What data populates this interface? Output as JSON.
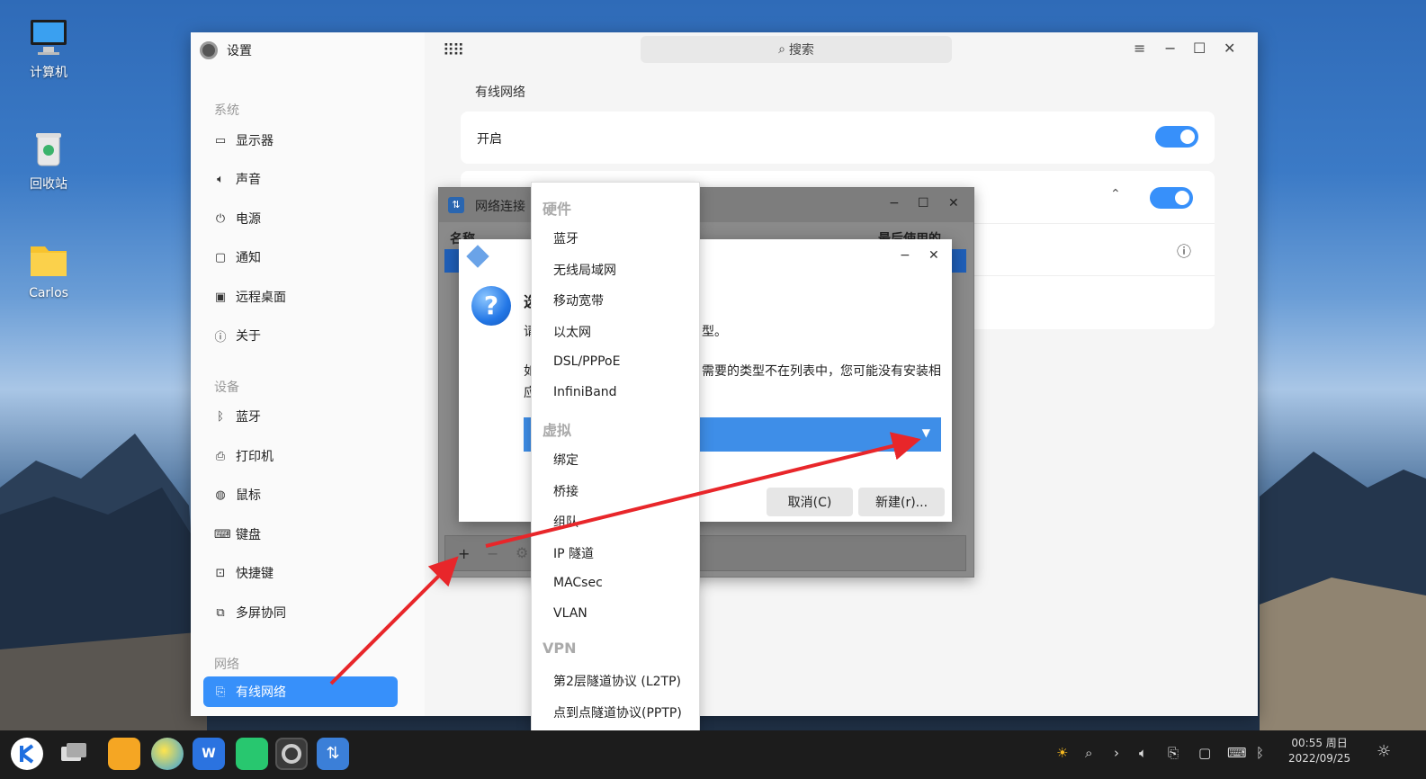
{
  "desktop": {
    "icons": [
      {
        "label": "计算机",
        "icon": "computer-icon"
      },
      {
        "label": "回收站",
        "icon": "trash-icon"
      },
      {
        "label": "Carlos",
        "icon": "folder-icon"
      }
    ]
  },
  "settings": {
    "title": "设置",
    "search_placeholder": "搜索",
    "sidebar": {
      "groups": {
        "system": "系统",
        "devices": "设备",
        "network": "网络"
      },
      "items": {
        "display": "显示器",
        "sound": "声音",
        "power": "电源",
        "notify": "通知",
        "remote": "远程桌面",
        "about": "关于",
        "bluetooth": "蓝牙",
        "printer": "打印机",
        "mouse": "鼠标",
        "keyboard": "键盘",
        "shortcuts": "快捷键",
        "multiscreen": "多屏协同",
        "wired": "有线网络"
      },
      "active": "有线网络"
    },
    "main": {
      "section_title": "有线网络",
      "enable_label": "开启",
      "enable_on": true,
      "connection_toggle_on": true
    }
  },
  "network_connections": {
    "title": "网络连接",
    "columns": [
      "名称",
      "最后使用的"
    ],
    "add_button": "+",
    "remove_button": "−",
    "settings_button": "⚙"
  },
  "choose_dialog": {
    "heading_visible": "选",
    "line1_start": "请",
    "line1_end": "型。",
    "line2_start": "如",
    "line2_end": "需要的类型不在列表中，您可能没有安装相",
    "line3_start": "应",
    "cancel_button": "取消(C)",
    "create_button": "新建(r)..."
  },
  "type_menu": {
    "groups": {
      "hardware": "硬件",
      "virtual": "虚拟",
      "vpn": "VPN"
    },
    "hardware": [
      "蓝牙",
      "无线局域网",
      "移动宽带",
      "以太网",
      "DSL/PPPoE",
      "InfiniBand"
    ],
    "virtual": [
      "绑定",
      "桥接",
      "组队",
      "IP 隧道",
      "MACsec",
      "VLAN"
    ],
    "vpn": [
      "第2层隧道协议 (L2TP)",
      "点到点隧道协议(PPTP)"
    ]
  },
  "taskbar": {
    "clock_time": "00:55 周日",
    "clock_date": "2022/09/25"
  },
  "colors": {
    "accent": "#3790fa",
    "annotation_arrow": "#e8262a"
  }
}
